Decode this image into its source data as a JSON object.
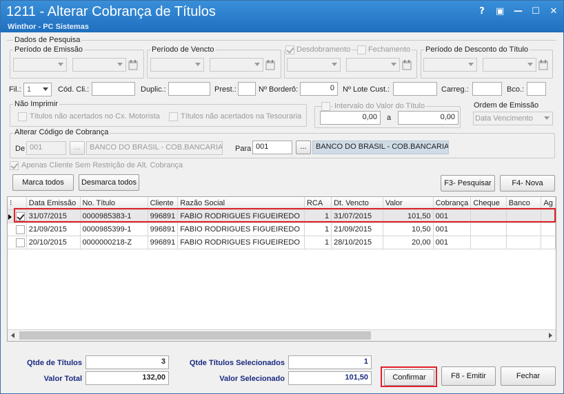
{
  "window": {
    "title": "1211 - Alterar Cobrança de Títulos",
    "subtitle": "Winthor - PC Sistemas",
    "controls": [
      "?",
      "▣",
      "—",
      "☐",
      "✕"
    ]
  },
  "pesquisa": {
    "group_title": "Dados de Pesquisa",
    "periodo_emissao": "Período de Emissão",
    "periodo_vencto": "Período de Vencto",
    "desdobramento": "Desdobramento",
    "fechamento": "Fechamento",
    "periodo_desconto": "Período de Desconto do Título",
    "fil_label": "Fil.:",
    "fil_value": "1",
    "cod_cli_label": "Cód. Cli.:",
    "duplic_label": "Duplic.:",
    "prest_label": "Prest.:",
    "bordero_label": "Nº Borderô:",
    "bordero_value": "0",
    "lote_label": "Nº Lote Cust.:",
    "carreg_label": "Carreg.:",
    "bco_label": "Bco.:",
    "nao_imprimir_title": "Não Imprimir",
    "nao_acertados_motorista": "Títulos não acertados no Cx. Motorista",
    "nao_acertados_tesouraria": "Títulos não acertados na Tesouraria",
    "intervalo_label": "Intervalo do Valor do Título",
    "intervalo_de": "0,00",
    "intervalo_a_label": "a",
    "intervalo_ate": "0,00",
    "ordem_label": "Ordem de Emissão",
    "ordem_value": "Data Vencimento",
    "alterar_title": "Alterar Código de Cobrança",
    "de_label": "De",
    "de_code": "001",
    "de_desc": "BANCO DO BRASIL - COB.BANCARIA",
    "para_label": "Para",
    "para_code": "001",
    "para_desc": "BANCO DO BRASIL - COB.BANCARIA",
    "ellipsis": "...",
    "apenas_cliente": "Apenas Cliente Sem Restrição de Alt. Cobrança"
  },
  "toolbar": {
    "marca_todos": "Marca todos",
    "desmarca_todos": "Desmarca todos",
    "pesquisar": "F3- Pesquisar",
    "nova": "F4- Nova"
  },
  "grid": {
    "columns": [
      "",
      "Data Emissão",
      "No. Título",
      "Cliente",
      "Razão Social",
      "RCA",
      "Dt. Vencto",
      "Valor",
      "Cobrança",
      "Cheque",
      "Banco",
      "Ag"
    ],
    "rows": [
      {
        "checked": true,
        "data_emissao": "31/07/2015",
        "no_titulo": "0000985383-1",
        "cliente": "996891",
        "razao": "FABIO RODRIGUES FIGUEIREDO",
        "rca": "1",
        "dt_vencto": "31/07/2015",
        "valor": "101,50",
        "cobranca": "001"
      },
      {
        "checked": false,
        "data_emissao": "21/09/2015",
        "no_titulo": "0000985399-1",
        "cliente": "996891",
        "razao": "FABIO RODRIGUES FIGUEIREDO",
        "rca": "1",
        "dt_vencto": "21/09/2015",
        "valor": "10,50",
        "cobranca": "001"
      },
      {
        "checked": false,
        "data_emissao": "20/10/2015",
        "no_titulo": "0000000218-Z",
        "cliente": "996891",
        "razao": "FABIO RODRIGUES FIGUEIREDO",
        "rca": "1",
        "dt_vencto": "28/10/2015",
        "valor": "20,00",
        "cobranca": "001"
      }
    ]
  },
  "totals": {
    "qtde_titulos_label": "Qtde de Títulos",
    "qtde_titulos": "3",
    "valor_total_label": "Valor Total",
    "valor_total": "132,00",
    "qtde_sel_label": "Qtde Títulos Selecionados",
    "qtde_sel": "1",
    "valor_sel_label": "Valor Selecionado",
    "valor_sel": "101,50"
  },
  "actions": {
    "confirmar": "Confirmar",
    "emitir": "F8 - Emitir",
    "fechar": "Fechar"
  },
  "colors": {
    "title_bar": "#2a7fcf",
    "highlight": "#e0202a",
    "label_navy": "#1a2a80"
  }
}
